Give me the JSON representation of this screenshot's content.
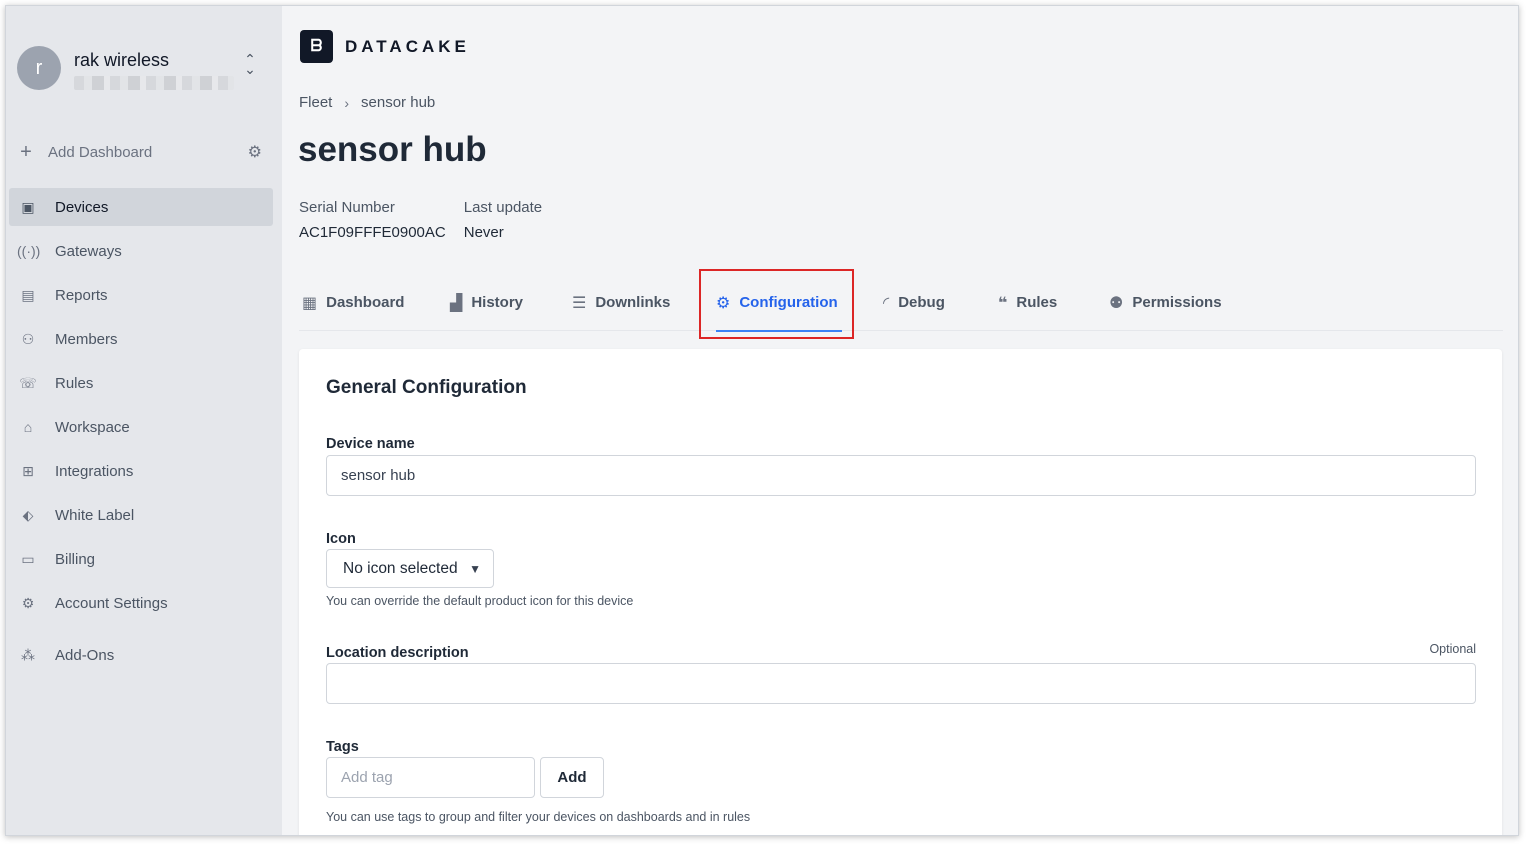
{
  "workspace": {
    "avatar_letter": "r",
    "name": "rak wireless"
  },
  "sidebar": {
    "add_dashboard": "Add Dashboard",
    "items": [
      {
        "label": "Devices",
        "icon": "devices-icon",
        "active": true
      },
      {
        "label": "Gateways",
        "icon": "gateway-icon"
      },
      {
        "label": "Reports",
        "icon": "report-icon"
      },
      {
        "label": "Members",
        "icon": "members-icon"
      },
      {
        "label": "Rules",
        "icon": "rules-icon"
      },
      {
        "label": "Workspace",
        "icon": "workspace-icon"
      },
      {
        "label": "Integrations",
        "icon": "integrations-icon"
      },
      {
        "label": "White Label",
        "icon": "tag-icon"
      },
      {
        "label": "Billing",
        "icon": "billing-icon"
      },
      {
        "label": "Account Settings",
        "icon": "gear-icon"
      },
      {
        "label": "Add-Ons",
        "icon": "addons-icon"
      }
    ]
  },
  "brand": {
    "name": "DATACAKE"
  },
  "breadcrumb": {
    "root": "Fleet",
    "current": "sensor hub"
  },
  "device": {
    "title": "sensor hub",
    "serial_label": "Serial Number",
    "serial_value": "AC1F09FFFE0900AC",
    "update_label": "Last update",
    "update_value": "Never"
  },
  "tabs": [
    {
      "label": "Dashboard",
      "icon": "table-icon"
    },
    {
      "label": "History",
      "icon": "bar-chart-icon"
    },
    {
      "label": "Downlinks",
      "icon": "sliders-icon"
    },
    {
      "label": "Configuration",
      "icon": "gear-icon",
      "active": true
    },
    {
      "label": "Debug",
      "icon": "rss-icon"
    },
    {
      "label": "Rules",
      "icon": "chat-icon"
    },
    {
      "label": "Permissions",
      "icon": "users-icon"
    }
  ],
  "config": {
    "title": "General Configuration",
    "device_name_label": "Device name",
    "device_name_value": "sensor hub",
    "icon_label": "Icon",
    "icon_value": "No icon selected",
    "icon_hint": "You can override the default product icon for this device",
    "location_label": "Location description",
    "optional": "Optional",
    "location_value": "",
    "tags_label": "Tags",
    "tag_placeholder": "Add tag",
    "add_label": "Add",
    "tags_hint": "You can use tags to group and filter your devices on dashboards and in rules"
  },
  "colors": {
    "accent": "#2563eb",
    "highlight": "#dc2626"
  }
}
